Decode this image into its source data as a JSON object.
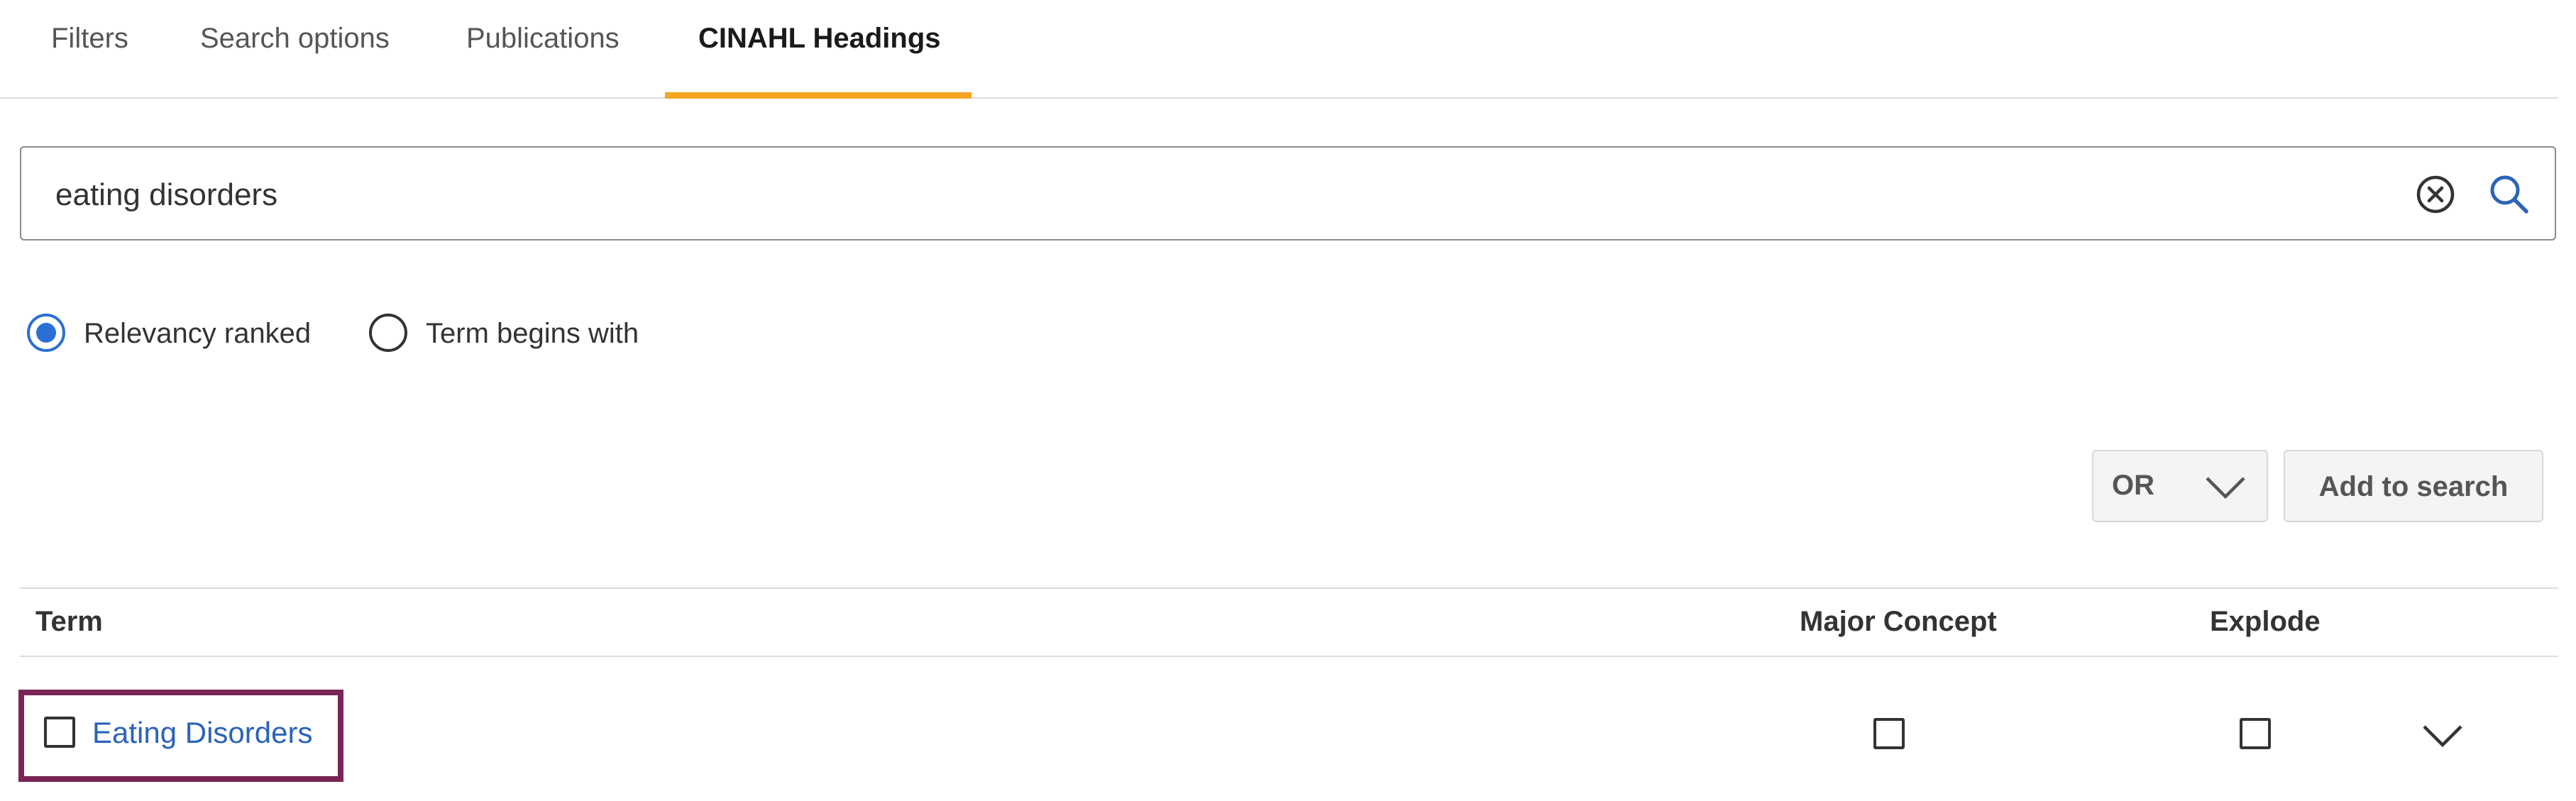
{
  "tabs": [
    {
      "label": "Filters",
      "active": false
    },
    {
      "label": "Search options",
      "active": false
    },
    {
      "label": "Publications",
      "active": false
    },
    {
      "label": "CINAHL Headings",
      "active": true
    }
  ],
  "search": {
    "value": "eating disorders",
    "clear_icon": "clear-circle-x-icon",
    "search_icon": "magnifier-icon"
  },
  "ranking_options": [
    {
      "label": "Relevancy ranked",
      "selected": true
    },
    {
      "label": "Term begins with",
      "selected": false
    }
  ],
  "actions": {
    "operator": "OR",
    "operator_icon": "chevron-down-icon",
    "add_label": "Add to search"
  },
  "table": {
    "headers": {
      "term": "Term",
      "major_concept": "Major Concept",
      "explode": "Explode"
    },
    "rows": [
      {
        "term": "Eating Disorders",
        "selected": false,
        "major_concept": false,
        "explode": false,
        "expand_icon": "chevron-down-icon"
      }
    ]
  },
  "colors": {
    "accent_tab": "#f5a623",
    "radio_selected": "#2b6fd6",
    "link": "#2b63b8",
    "highlight_box": "#7b2456",
    "search_icon": "#2b63b8"
  }
}
